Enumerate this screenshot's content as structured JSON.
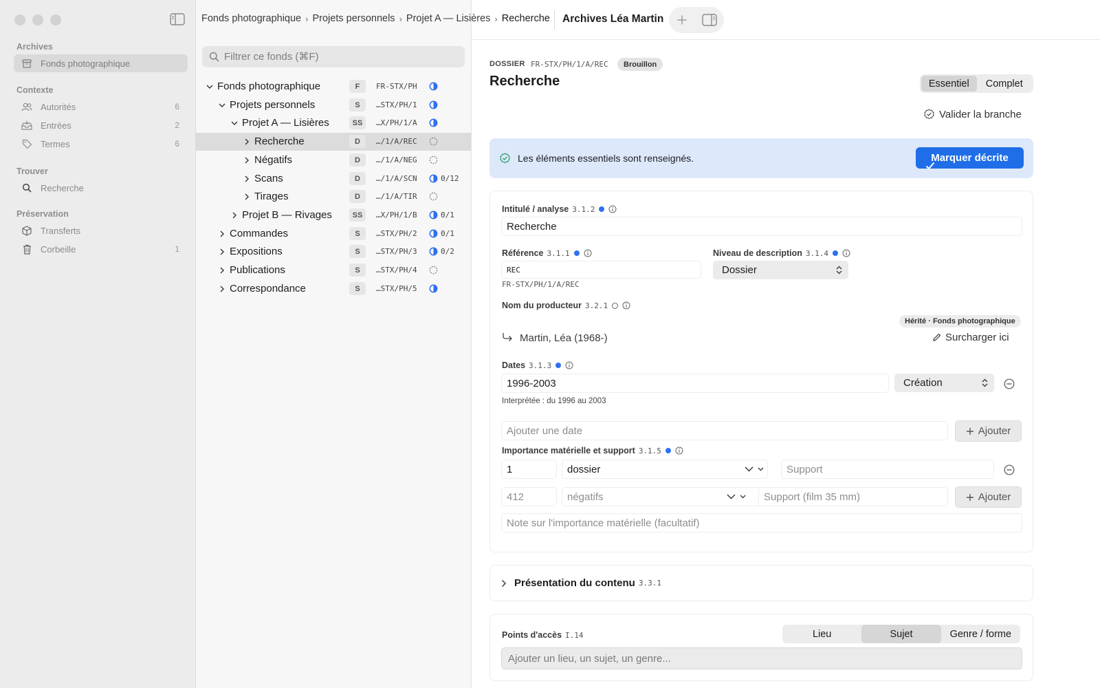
{
  "sidebar": {
    "sections": {
      "archives": "Archives",
      "contexte": "Contexte",
      "trouver": "Trouver",
      "preservation": "Préservation"
    },
    "items": {
      "fonds": {
        "label": "Fonds photographique",
        "icon": "archive-box-icon"
      },
      "autorites": {
        "label": "Autorités",
        "count": "6",
        "icon": "people-icon"
      },
      "entrees": {
        "label": "Entrées",
        "count": "2",
        "icon": "inbox-tray-icon"
      },
      "termes": {
        "label": "Termes",
        "count": "6",
        "icon": "tag-icon"
      },
      "recherche": {
        "label": "Recherche",
        "icon": "search-icon"
      },
      "transferts": {
        "label": "Transferts",
        "icon": "cube-icon"
      },
      "corbeille": {
        "label": "Corbeille",
        "count": "1",
        "icon": "trash-icon"
      }
    }
  },
  "breadcrumb": [
    "Fonds photographique",
    "Projets personnels",
    "Projet A — Lisières",
    "Recherche"
  ],
  "filter": {
    "placeholder": "Filtrer ce fonds (⌘F)"
  },
  "tree": [
    {
      "name": "Fonds photographique",
      "level": "F",
      "code": "FR-STX/PH",
      "status": "half",
      "progress": "",
      "expanded": true,
      "selected": false
    },
    {
      "name": "Projets personnels",
      "level": "S",
      "code": "…STX/PH/1",
      "status": "half",
      "progress": "",
      "expanded": true,
      "selected": false
    },
    {
      "name": "Projet A — Lisières",
      "level": "SS",
      "code": "…X/PH/1/A",
      "status": "half",
      "progress": "",
      "expanded": true,
      "selected": false
    },
    {
      "name": "Recherche",
      "level": "D",
      "code": "…/1/A/REC",
      "status": "empty",
      "progress": "",
      "expanded": false,
      "selected": true
    },
    {
      "name": "Négatifs",
      "level": "D",
      "code": "…/1/A/NEG",
      "status": "empty",
      "progress": "",
      "expanded": false,
      "selected": false
    },
    {
      "name": "Scans",
      "level": "D",
      "code": "…/1/A/SCN",
      "status": "half",
      "progress": "0/12",
      "expanded": false,
      "selected": false
    },
    {
      "name": "Tirages",
      "level": "D",
      "code": "…/1/A/TIR",
      "status": "empty",
      "progress": "",
      "expanded": false,
      "selected": false
    },
    {
      "name": "Projet B — Rivages",
      "level": "SS",
      "code": "…X/PH/1/B",
      "status": "half",
      "progress": "0/1",
      "expanded": false,
      "selected": false
    },
    {
      "name": "Commandes",
      "level": "S",
      "code": "…STX/PH/2",
      "status": "half",
      "progress": "0/1",
      "expanded": false,
      "selected": false
    },
    {
      "name": "Expositions",
      "level": "S",
      "code": "…STX/PH/3",
      "status": "half",
      "progress": "0/2",
      "expanded": false,
      "selected": false
    },
    {
      "name": "Publications",
      "level": "S",
      "code": "…STX/PH/4",
      "status": "empty",
      "progress": "",
      "expanded": false,
      "selected": false
    },
    {
      "name": "Correspondance",
      "level": "S",
      "code": "…STX/PH/5",
      "status": "half",
      "progress": "",
      "expanded": false,
      "selected": false
    }
  ],
  "header": {
    "title": "Archives Léa Martin"
  },
  "detail": {
    "kind": "DOSSIER",
    "refpath": "FR-STX/PH/1/A/REC",
    "badge": "Brouillon",
    "title": "Recherche",
    "modes": [
      "Essentiel",
      "Complet"
    ],
    "active_mode": "Essentiel",
    "validate_label": "Valider la branche",
    "banner_text": "Les éléments essentiels sont renseignés.",
    "mark_button": "Marquer décrite"
  },
  "identity": {
    "intitule": {
      "label": "Intitulé / analyse",
      "num": "3.1.2",
      "value": "Recherche"
    },
    "reference": {
      "label": "Référence",
      "num": "3.1.1",
      "value": "REC",
      "full": "FR-STX/PH/1/A/REC"
    },
    "niveau": {
      "label": "Niveau de description",
      "num": "3.1.4",
      "value": "Dossier"
    },
    "producteur": {
      "label": "Nom du producteur",
      "num": "3.2.1",
      "inherited_badge": "Hérité · Fonds photographique",
      "value": "Martin, Léa (1968-)",
      "override": "Surcharger ici"
    },
    "dates": {
      "label": "Dates",
      "num": "3.1.3",
      "value": "1996-2003",
      "type": "Création",
      "interpreted": "Interprétée : du 1996 au 2003",
      "add_placeholder": "Ajouter une date",
      "add_button": "Ajouter"
    },
    "importance": {
      "label": "Importance matérielle et support",
      "num": "3.1.5",
      "row1": {
        "qty": "1",
        "unit": "dossier",
        "support_placeholder": "Support"
      },
      "row2": {
        "qty_placeholder": "412",
        "unit_placeholder": "négatifs",
        "support_placeholder": "Support (film 35 mm)",
        "add_button": "Ajouter"
      },
      "note_placeholder": "Note sur l'importance matérielle (facultatif)"
    }
  },
  "contenu": {
    "label": "Présentation du contenu",
    "num": "3.3.1"
  },
  "acces": {
    "label": "Points d'accès",
    "num": "I.14",
    "tabs": [
      "Lieu",
      "Sujet",
      "Genre / forme"
    ],
    "active_tab": "Sujet",
    "placeholder": "Ajouter un lieu, un sujet, un genre..."
  },
  "colors": {
    "accent": "#1f6ee8",
    "banner": "#dde8fb",
    "required_dot": "#2f6ff0"
  }
}
